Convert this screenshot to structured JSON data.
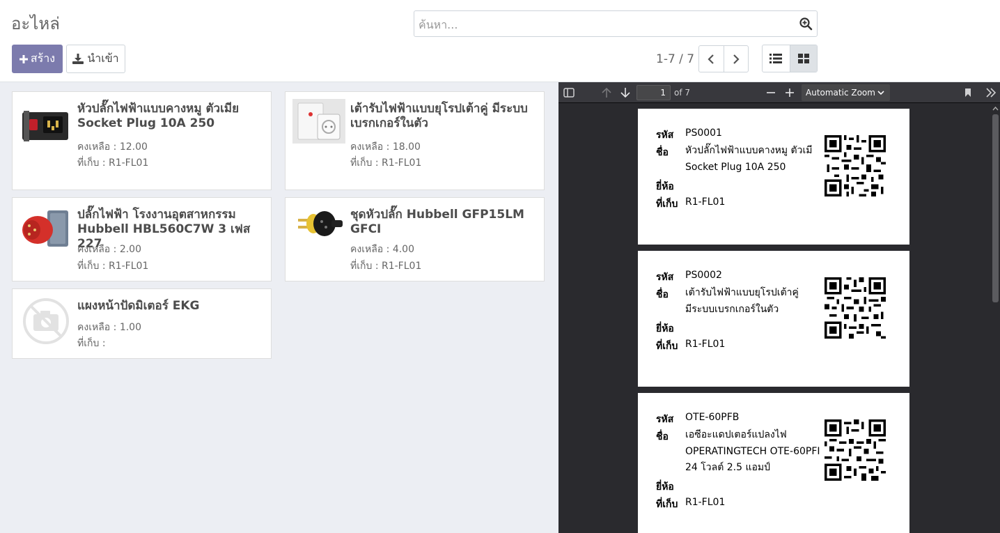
{
  "header": {
    "title": "อะไหล่",
    "search_placeholder": "ค้นหา...",
    "create_label": "สร้าง",
    "import_label": "นำเข้า",
    "pager_value": "1-7 / 7"
  },
  "field_labels": {
    "stock": "คงเหลือ : ",
    "location": "ที่เก็บ : "
  },
  "cards": [
    {
      "title": "หัวปลั๊กไฟฟ้าแบบคางหมู ตัวเมีย Socket Plug 10A 250",
      "stock": "12.00",
      "location": "R1-FL01",
      "image": "ac-socket-image"
    },
    {
      "title": "เต้ารับไฟฟ้าแบบยุโรปเต้าคู่ มีระบบเบรกเกอร์ในตัว",
      "stock": "18.00",
      "location": "R1-FL01",
      "image": "wall-outlet-image"
    },
    {
      "title": "ปลั๊กไฟฟ้า โรงงานอุตสาหกรรม Hubbell HBL560C7W 3 เฟส 227",
      "stock": "2.00",
      "location": "R1-FL01",
      "image": "industrial-plug-image"
    },
    {
      "title": "ชุดหัวปลั๊ก Hubbell GFP15LM GFCI",
      "stock": "4.00",
      "location": "R1-FL01",
      "image": "gfci-plug-image"
    },
    {
      "title": "แผงหน้าปัดมิเตอร์ EKG",
      "stock": "1.00",
      "location": "",
      "image": "no-image-placeholder"
    }
  ],
  "pdf": {
    "current_page": "1",
    "page_count": "of 7",
    "zoom": "Automatic Zoom",
    "labels": {
      "code": "รหัส",
      "name": "ชื่อ",
      "brand": "ยี่ห้อ",
      "location": "ที่เก็บ"
    },
    "pages": [
      {
        "code": "PS0001",
        "name_lines": [
          "หัวปลั๊กไฟฟ้าแบบคางหมู ตัวเมี",
          "Socket Plug 10A 250"
        ],
        "brand": "",
        "location": "R1-FL01"
      },
      {
        "code": "PS0002",
        "name_lines": [
          "เต้ารับไฟฟ้าแบบยุโรปเต้าคู่",
          "มีระบบเบรกเกอร์ในตัว"
        ],
        "brand": "",
        "location": "R1-FL01"
      },
      {
        "code": "OTE-60PFB",
        "name_lines": [
          "เอซีอะแดปเตอร์แปลงไฟ",
          "OPERATINGTECH OTE-60PFI",
          "24 โวลต์ 2.5 แอมป์"
        ],
        "brand": "",
        "location": "R1-FL01"
      }
    ]
  },
  "colors": {
    "primary": "#7c7bad",
    "kanban_bg": "#eceef3",
    "pdf_bg": "#2a2a2e",
    "pdf_toolbar": "#38383d"
  }
}
